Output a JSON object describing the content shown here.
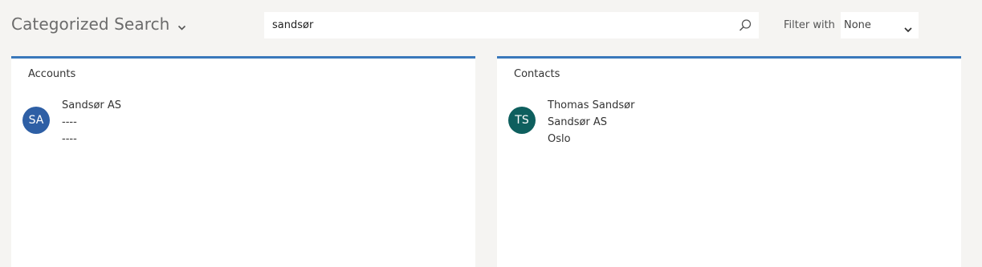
{
  "header": {
    "title": "Categorized Search",
    "search_value": "sandsør",
    "filter_label": "Filter with",
    "filter_value": "None"
  },
  "accounts": {
    "title": "Accounts",
    "results": [
      {
        "initials": "SA",
        "avatar_color": "#2e5fa5",
        "lines": [
          "Sandsør AS",
          "----",
          "----"
        ]
      }
    ]
  },
  "contacts": {
    "title": "Contacts",
    "results": [
      {
        "initials": "TS",
        "avatar_color": "#0e5f5e",
        "lines": [
          "Thomas Sandsør",
          "Sandsør AS",
          "Oslo"
        ]
      }
    ]
  },
  "colors": {
    "accent": "#3a78bb",
    "background": "#f5f4f2"
  }
}
